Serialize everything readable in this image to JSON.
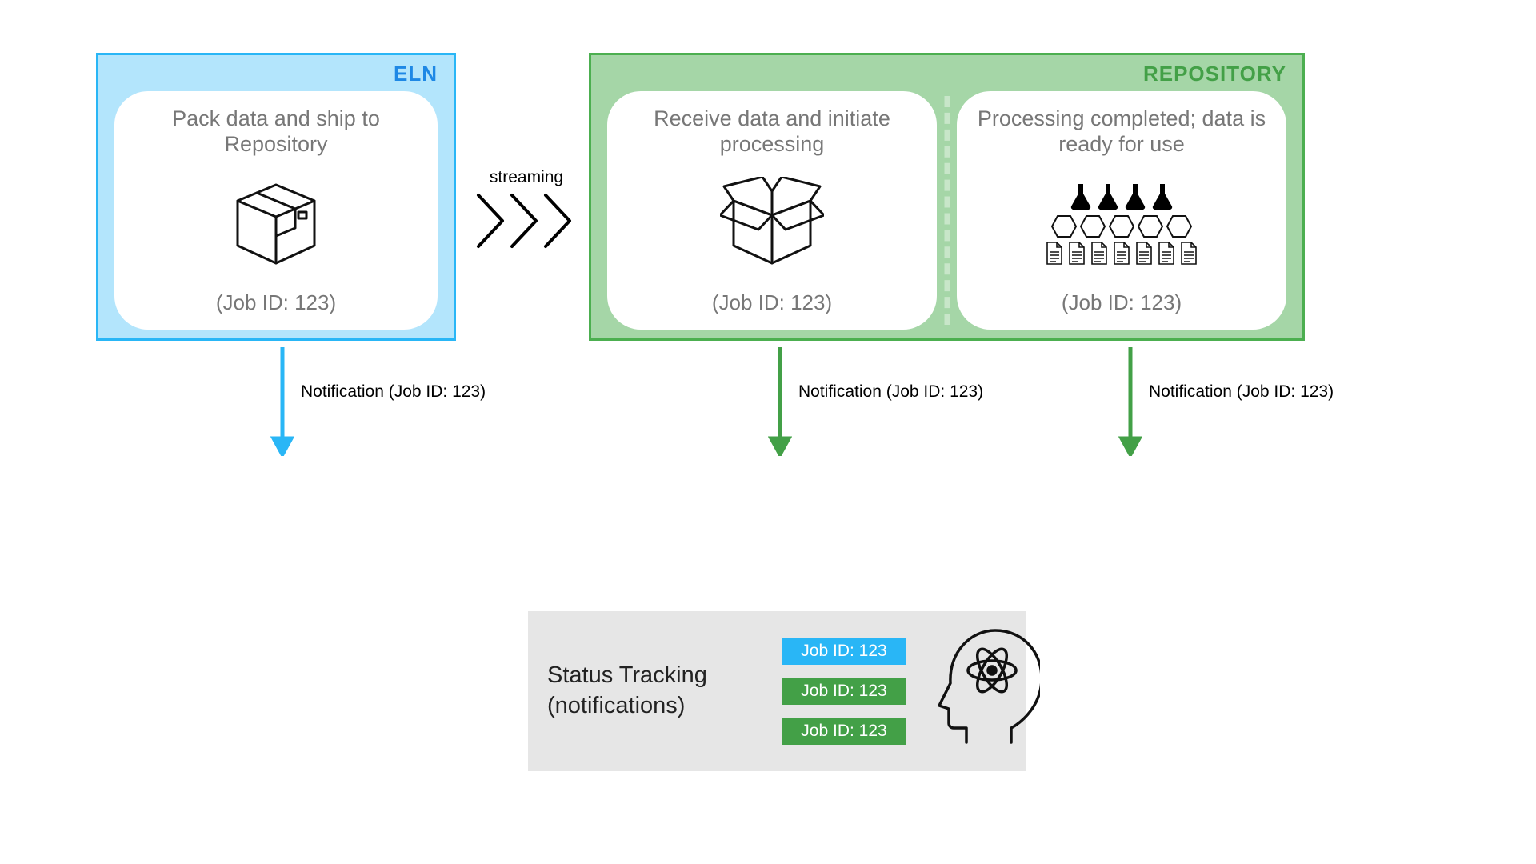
{
  "eln": {
    "title": "ELN",
    "card": {
      "title": "Pack data and ship to Repository",
      "jobid": "(Job ID: 123)"
    },
    "notification": "Notification (Job ID: 123)"
  },
  "repository": {
    "title": "REPOSITORY",
    "card_receive": {
      "title": "Receive data and initiate processing",
      "jobid": "(Job ID: 123)"
    },
    "card_done": {
      "title": "Processing completed; data is ready for use",
      "jobid": "(Job ID: 123)"
    },
    "notification_receive": "Notification (Job ID: 123)",
    "notification_done": "Notification (Job ID: 123)"
  },
  "streaming": {
    "label": "streaming"
  },
  "status": {
    "title_line1": "Status Tracking",
    "title_line2": "(notifications)",
    "badges": [
      {
        "label": "Job ID: 123",
        "color": "blue"
      },
      {
        "label": "Job ID: 123",
        "color": "green"
      },
      {
        "label": "Job ID: 123",
        "color": "green"
      }
    ]
  },
  "colors": {
    "blue": "#29b6f6",
    "green": "#4caf50",
    "green_dark": "#43a047"
  }
}
